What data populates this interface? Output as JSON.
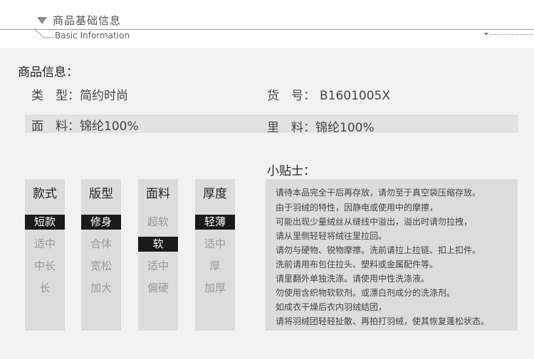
{
  "header": {
    "title": "商品基础信息",
    "subtitle": "Basic Information"
  },
  "product_info": {
    "heading": "商品信息：",
    "type_label": "类　型：",
    "type_value": "简约时尚",
    "sku_label": "货　号：",
    "sku_value": "B1601005X",
    "outer_label": "面　料：",
    "outer_value": "锦纶100%",
    "lining_label": "里　料：",
    "lining_value": "锦纶100%"
  },
  "attributes": [
    {
      "title": "款式",
      "options": [
        "短款",
        "适中",
        "中长",
        "长"
      ],
      "selected": "短款"
    },
    {
      "title": "版型",
      "options": [
        "修身",
        "合体",
        "宽松",
        "加大"
      ],
      "selected": "修身"
    },
    {
      "title": "面料",
      "options": [
        "超软",
        "软",
        "适中",
        "偏硬"
      ],
      "selected": "软"
    },
    {
      "title": "厚度",
      "options": [
        "轻薄",
        "适中",
        "厚",
        "加厚"
      ],
      "selected": "轻薄"
    }
  ],
  "tips": {
    "heading": "小贴士：",
    "lines": [
      "请待本品完全干后再存放，请勿至于真空袋压缩存放。",
      "由于羽绒的特性，因静电或使用中的摩擦，",
      "可能出现少量绒丝从缝线中溢出，溢出时请勿拉拽，",
      "请从里侧轻轻将绒往里拉回。",
      "请勿与硬物、锐物摩擦。洗前请拉上拉链、扣上扣件。",
      "洗前请用布包住拉头、塑料或金属配件等。",
      "请里翻外单独洗涤。请使用中性洗涤液。",
      "勿使用含织物软软剂。或漂白剂成分的洗涤剂。",
      "如成衣干燥后衣内羽绒结团，",
      "请将羽绒团轻轻扯散、再拍打羽绒，使其恢复蓬松状态。"
    ]
  }
}
